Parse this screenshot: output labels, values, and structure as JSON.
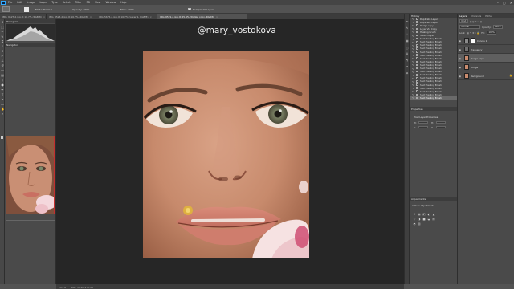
{
  "menubar": {
    "items": [
      "File",
      "Edit",
      "Image",
      "Layer",
      "Type",
      "Select",
      "Filter",
      "3D",
      "View",
      "Window",
      "Help"
    ],
    "window_controls": [
      "–",
      "▢",
      "✕"
    ]
  },
  "options_bar": {
    "mode_label": "Mode: Normal",
    "opacity_label": "Opacity: 100%",
    "flow_label": "Flow: 100%",
    "sample_label": "Sample All Layers"
  },
  "document_tabs": [
    {
      "label": "IMG_9527-2.jpg @ 16.7% (RGB/8)",
      "active": false
    },
    {
      "label": "IMG_9523-2.jpg @ 16.7% (RGB/8)",
      "active": false
    },
    {
      "label": "IMG_5675-2.jpg @ 16.7% (Layer 1, RGB/8)",
      "active": false
    },
    {
      "label": "IMG_9521-2.jpg @ 25.4% (Dodge copy, RGB/8)",
      "active": true
    }
  ],
  "left_panels": {
    "histogram_title": "Histogram",
    "navigator_title": "Navigator",
    "navigator_zoom": "25.4%"
  },
  "canvas": {
    "watermark": "@mary_vostokova"
  },
  "status_bar": {
    "zoom": "25.4%",
    "doc_info": "Doc: 57.1M/171.3M"
  },
  "history": {
    "title": "History",
    "items": [
      "Duplicate Layer",
      "Duplicate Layer",
      "Dodge copy",
      "Layer Via Copy",
      "Healing Brush",
      "Select Layer",
      "Spot Healing Brush",
      "Spot Healing Brush",
      "Spot Healing Brush",
      "Spot Healing Brush",
      "Spot Healing Brush",
      "Spot Healing Brush",
      "Spot Healing Brush",
      "Spot Healing Brush",
      "Spot Healing Brush",
      "Spot Healing Brush",
      "Spot Healing Brush",
      "Spot Healing Brush",
      "Spot Healing Brush",
      "Spot Healing Brush",
      "Spot Healing Brush",
      "Spot Healing Brush",
      "Spot Healing Brush",
      "Spot Healing Brush",
      "Spot Healing Brush"
    ],
    "selected_index": 24
  },
  "properties": {
    "title": "Properties",
    "subtitle": "Pixel Layer Properties",
    "w_label": "W:",
    "h_label": "H:",
    "x_label": "X:",
    "y_label": "Y:"
  },
  "adjustments": {
    "title": "Adjustments",
    "subtitle": "Add an adjustment",
    "icons": [
      "☀",
      "▦",
      "◩",
      "◐",
      "▲",
      "▽",
      "◑",
      "■",
      "◒",
      "▤",
      "◔",
      "▥"
    ]
  },
  "layers": {
    "tabs": [
      "Layers",
      "Channels",
      "Paths"
    ],
    "kind_label": "Kind",
    "blend_mode": "Normal",
    "opacity_label": "Opacity:",
    "opacity_value": "100%",
    "lock_label": "Lock:",
    "fill_label": "Fill:",
    "fill_value": "100%",
    "rows": [
      {
        "name": "Curves 1",
        "type": "adjustment",
        "selected": false
      },
      {
        "name": "Frequency",
        "type": "group",
        "selected": false
      },
      {
        "name": "Dodge copy",
        "type": "pixel",
        "selected": true
      },
      {
        "name": "Dodge",
        "type": "pixel",
        "selected": false
      },
      {
        "name": "Background",
        "type": "pixel",
        "locked": true,
        "selected": false
      }
    ]
  }
}
